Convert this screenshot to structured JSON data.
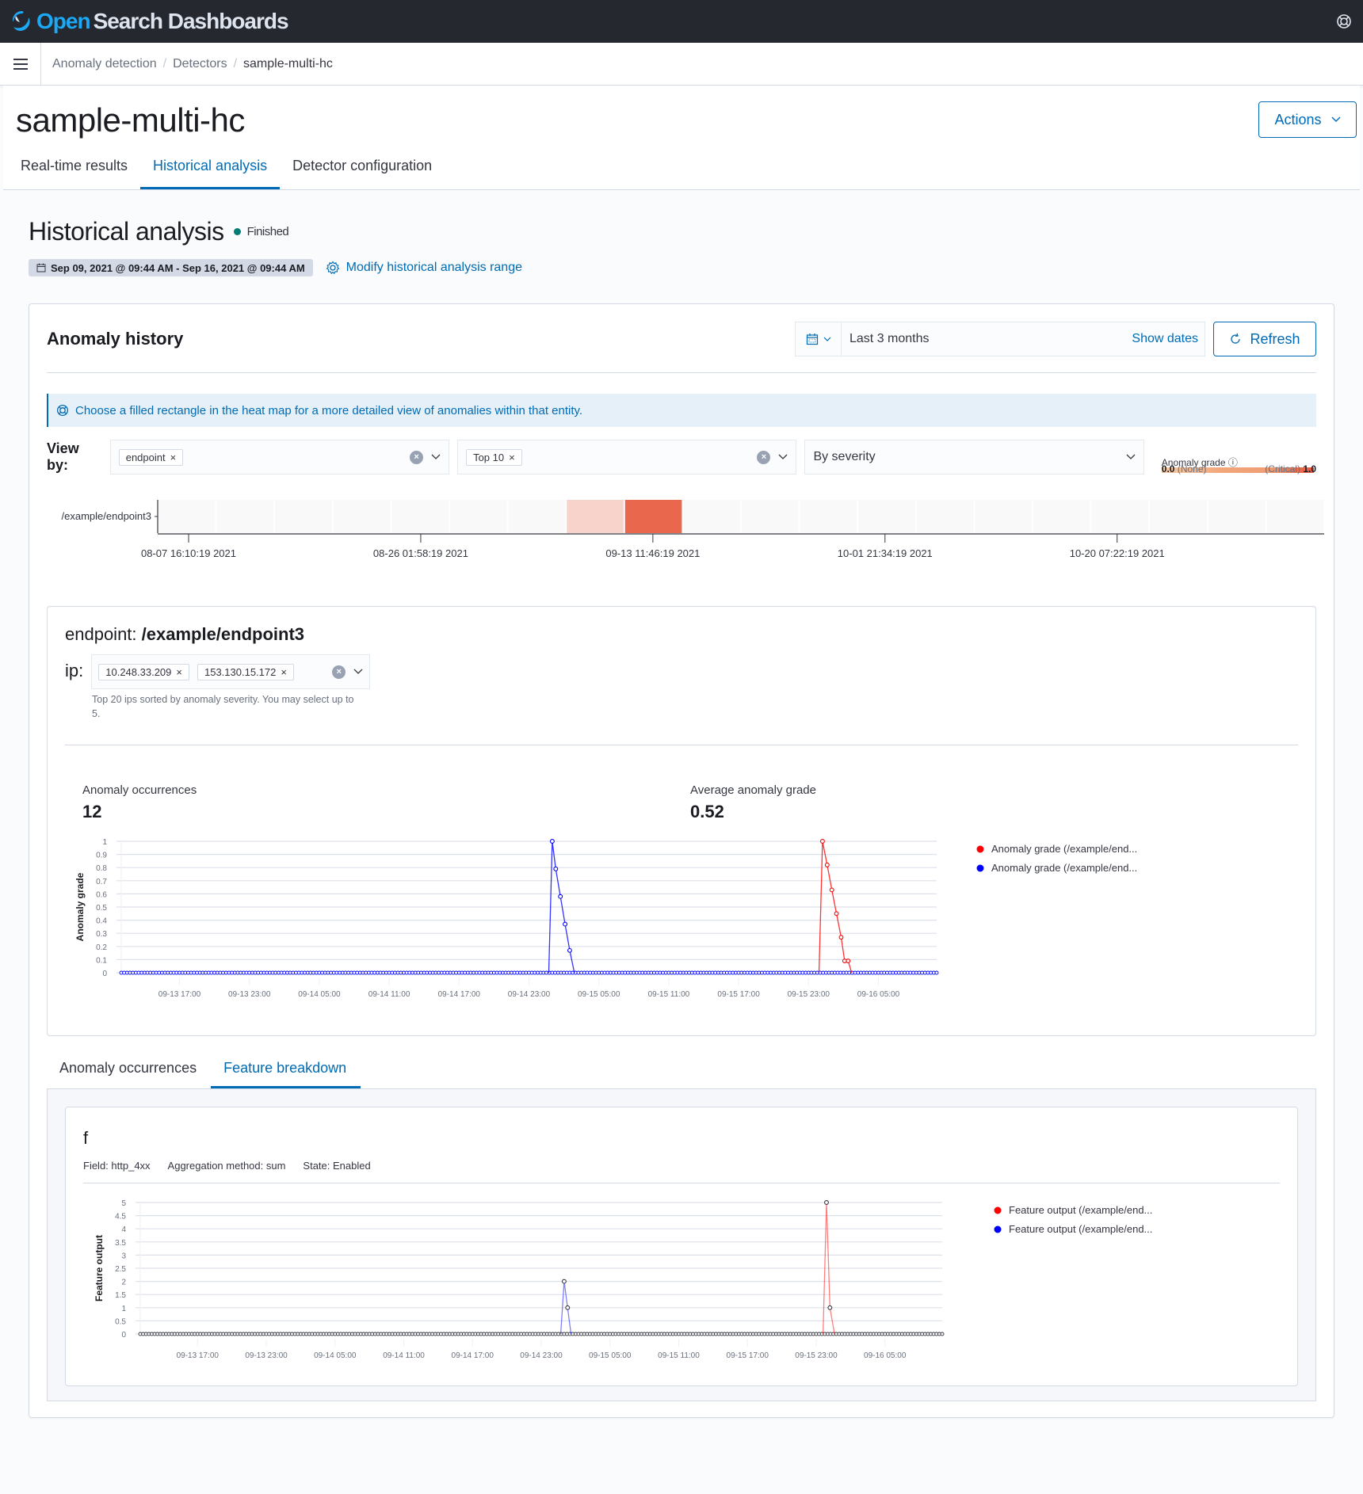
{
  "app": {
    "brand_open": "Open",
    "brand_rest": "Search Dashboards"
  },
  "breadcrumbs": [
    {
      "label": "Anomaly detection"
    },
    {
      "label": "Detectors"
    },
    {
      "label": "sample-multi-hc"
    }
  ],
  "header": {
    "title": "sample-multi-hc",
    "actions_label": "Actions",
    "tabs": [
      {
        "label": "Real-time results",
        "active": false
      },
      {
        "label": "Historical analysis",
        "active": true
      },
      {
        "label": "Detector configuration",
        "active": false
      }
    ]
  },
  "historical": {
    "title": "Historical analysis",
    "status": "Finished",
    "status_color": "#017d73",
    "range": "Sep 09, 2021 @ 09:44 AM - Sep 16, 2021 @ 09:44 AM",
    "modify_label": "Modify historical analysis range"
  },
  "anomaly_history": {
    "title": "Anomaly history",
    "date_range": "Last 3 months",
    "show_dates": "Show dates",
    "refresh": "Refresh",
    "callout": "Choose a filled rectangle in the heat map for a more detailed view of anomalies within that entity.",
    "view_by_label": "View by:",
    "view_by_chip": "endpoint",
    "top_chip": "Top 10",
    "sort_select": "By severity",
    "grade_legend": {
      "title": "Anomaly grade",
      "min_label": "0.0",
      "min_text": "(None)",
      "max_text": "(Critical)",
      "max_label": "1.0"
    }
  },
  "entity": {
    "prefix": "endpoint: ",
    "name": "/example/endpoint3",
    "ip_label": "ip:",
    "ip_chips": [
      "10.248.33.209",
      "153.130.15.172"
    ],
    "help": "Top 20 ips sorted by anomaly severity. You may select up to 5.",
    "stats": [
      {
        "label": "Anomaly occurrences",
        "value": "12"
      },
      {
        "label": "Average anomaly grade",
        "value": "0.52"
      }
    ]
  },
  "sub_tabs": [
    {
      "label": "Anomaly occurrences",
      "active": false
    },
    {
      "label": "Feature breakdown",
      "active": true
    }
  ],
  "feature": {
    "name": "f",
    "field": "Field: http_4xx",
    "aggregation": "Aggregation method: sum",
    "state": "State: Enabled"
  },
  "chart_data": [
    {
      "type": "heatmap",
      "y_categories": [
        "/example/endpoint3"
      ],
      "x_ticks": [
        "08-07 16:10:19 2021",
        "08-26 01:58:19 2021",
        "09-13 11:46:19 2021",
        "10-01 21:34:19 2021",
        "10-20 07:22:19 2021"
      ],
      "cells": 20,
      "values": [
        0,
        0,
        0,
        0,
        0,
        0,
        0,
        0.2,
        0.85,
        0,
        0,
        0,
        0,
        0,
        0,
        0,
        0,
        0,
        0,
        0
      ],
      "colors": {
        "empty": "#f9f9f9",
        "low": "#f8d3cc",
        "high": "#e8674d"
      }
    },
    {
      "type": "line",
      "ylabel": "Anomaly grade",
      "ylim": [
        0,
        1
      ],
      "yticks": [
        "0",
        "0.1",
        "0.2",
        "0.3",
        "0.4",
        "0.5",
        "0.6",
        "0.7",
        "0.8",
        "0.9",
        "1"
      ],
      "x_ticks": [
        "09-13 17:00",
        "09-13 23:00",
        "09-14 05:00",
        "09-14 11:00",
        "09-14 17:00",
        "09-14 23:00",
        "09-15 05:00",
        "09-15 11:00",
        "09-15 17:00",
        "09-15 23:00",
        "09-16 05:00"
      ],
      "x_range_hours": [
        0,
        70
      ],
      "first_tick_hour": 5,
      "series": [
        {
          "name": "Anomaly grade (/example/end...",
          "color": "#ff0000",
          "points": [
            [
              59.9,
              0
            ],
            [
              60.2,
              1.0
            ],
            [
              60.6,
              0.82
            ],
            [
              61.0,
              0.63
            ],
            [
              61.4,
              0.45
            ],
            [
              61.8,
              0.27
            ],
            [
              62.1,
              0.09
            ],
            [
              62.4,
              0.09
            ],
            [
              62.7,
              0
            ]
          ]
        },
        {
          "name": "Anomaly grade (/example/end...",
          "color": "#0000ff",
          "points": [
            [
              36.7,
              0
            ],
            [
              37.0,
              1.0
            ],
            [
              37.3,
              0.79
            ],
            [
              37.7,
              0.58
            ],
            [
              38.1,
              0.37
            ],
            [
              38.5,
              0.17
            ],
            [
              38.9,
              0
            ]
          ]
        }
      ]
    },
    {
      "type": "line",
      "ylabel": "Feature output",
      "ylim": [
        0,
        5
      ],
      "yticks": [
        "0",
        "0.5",
        "1",
        "1.5",
        "2",
        "2.5",
        "3",
        "3.5",
        "4",
        "4.5",
        "5"
      ],
      "x_ticks": [
        "09-13 17:00",
        "09-13 23:00",
        "09-14 05:00",
        "09-14 11:00",
        "09-14 17:00",
        "09-14 23:00",
        "09-15 05:00",
        "09-15 11:00",
        "09-15 17:00",
        "09-15 23:00",
        "09-16 05:00"
      ],
      "x_range_hours": [
        0,
        70
      ],
      "first_tick_hour": 5,
      "series": [
        {
          "name": "Feature output (/example/end...",
          "color": "#ff0000",
          "points": [
            [
              59.6,
              0
            ],
            [
              59.9,
              5
            ],
            [
              60.2,
              1
            ],
            [
              60.6,
              0
            ]
          ]
        },
        {
          "name": "Feature output (/example/end...",
          "color": "#0000ff",
          "points": [
            [
              36.7,
              0
            ],
            [
              37.0,
              2
            ],
            [
              37.3,
              1
            ],
            [
              37.6,
              0
            ]
          ]
        }
      ]
    }
  ]
}
